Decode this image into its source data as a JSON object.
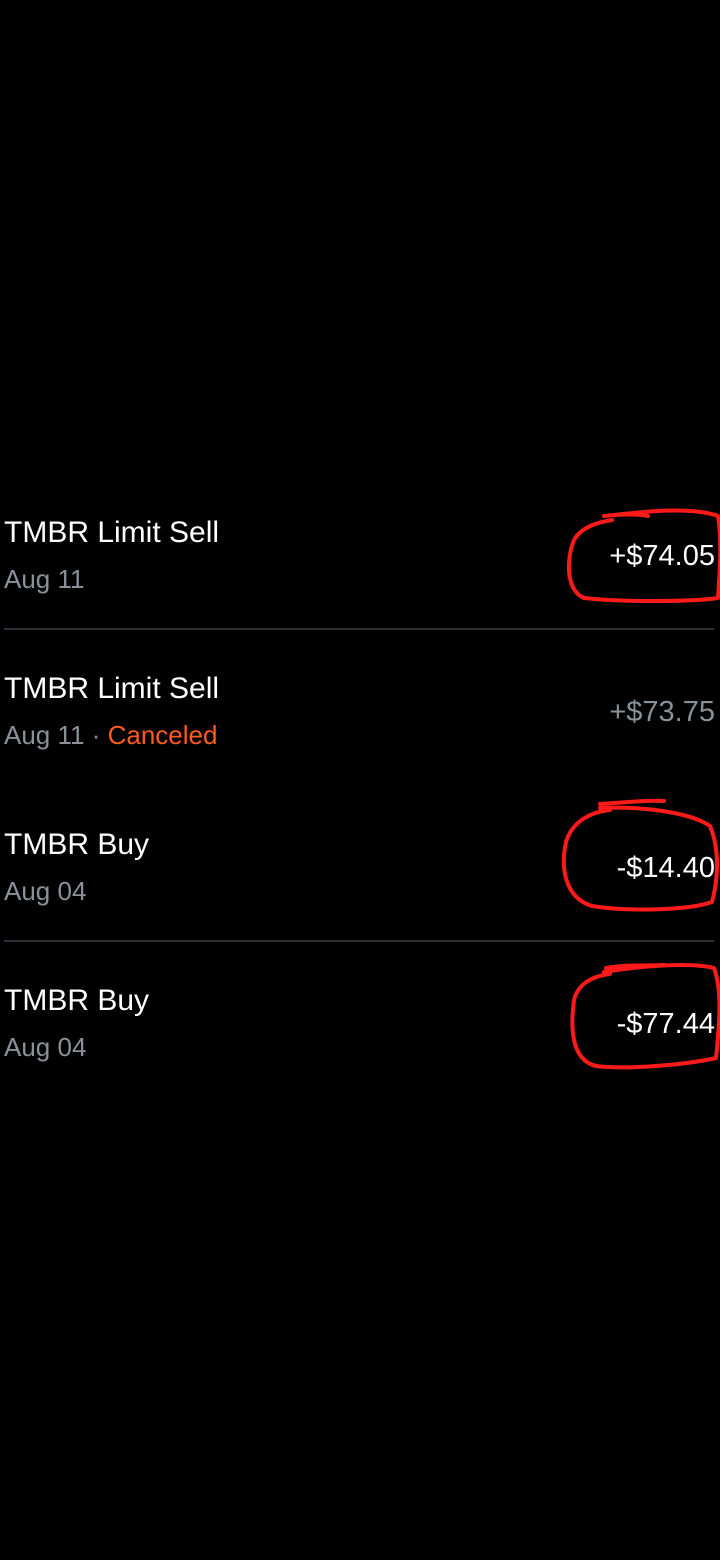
{
  "orders": [
    {
      "title": "TMBR Limit Sell",
      "date": "Aug 11",
      "status": "",
      "amount": "+$74.05",
      "amount_style": "settled",
      "has_divider": true
    },
    {
      "title": "TMBR Limit Sell",
      "date": "Aug 11",
      "separator": "·",
      "status": "Canceled",
      "amount": "+$73.75",
      "amount_style": "muted",
      "has_divider": false
    },
    {
      "title": "TMBR Buy",
      "date": "Aug 04",
      "status": "",
      "amount": "-$14.40",
      "amount_style": "settled",
      "has_divider": true
    },
    {
      "title": "TMBR Buy",
      "date": "Aug 04",
      "status": "",
      "amount": "-$77.44",
      "amount_style": "settled",
      "has_divider": false
    }
  ],
  "colors": {
    "background": "#000000",
    "primary_text": "#ffffff",
    "secondary_text": "#8a9199",
    "canceled_status": "#ff5a1f",
    "divider": "#2c2f33",
    "annotation_marker": "#ff1a1a"
  },
  "annotations": {
    "description_icons": [
      "hand-drawn-circle-icon"
    ]
  }
}
